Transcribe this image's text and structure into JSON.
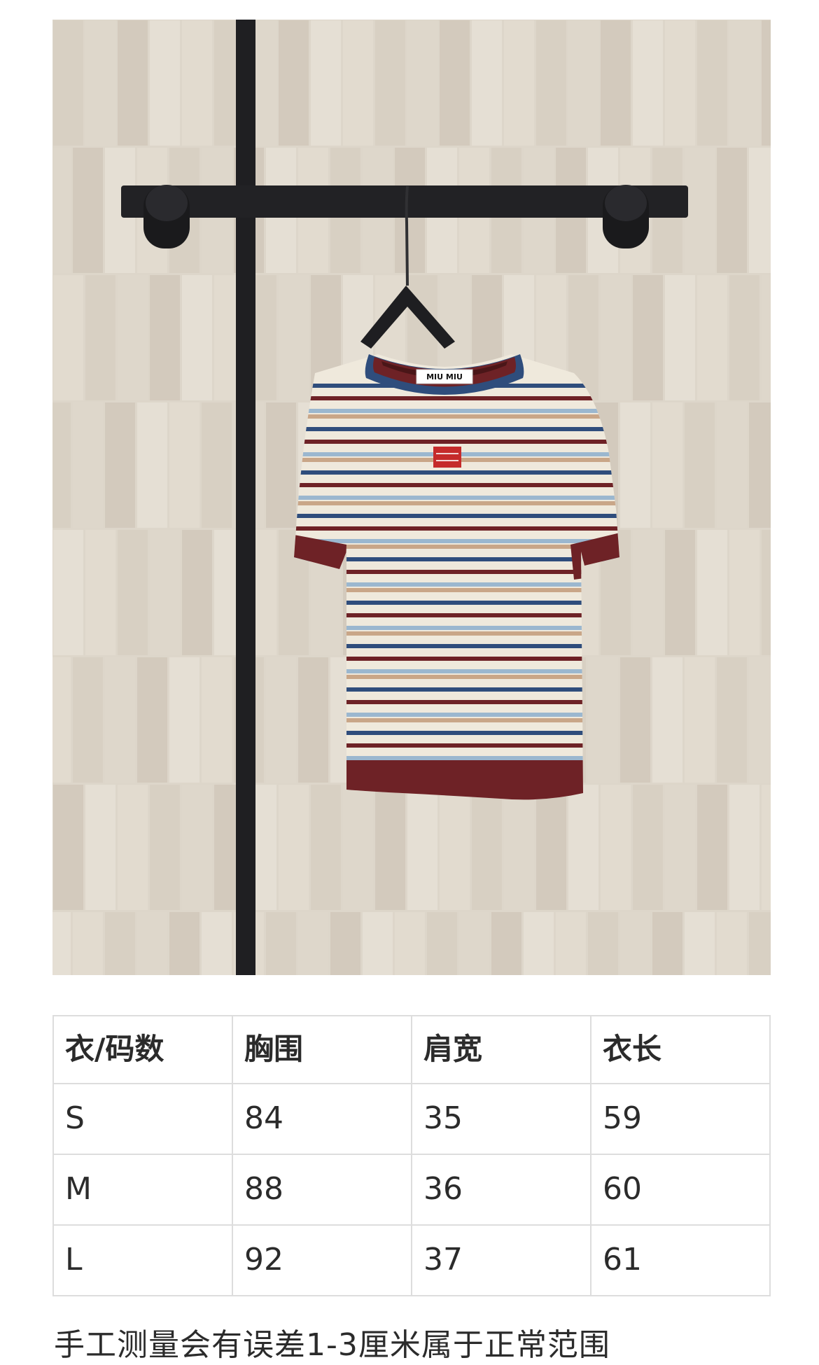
{
  "photo": {
    "icon": "striped-knit-tshirt-on-hanger-photo",
    "label_text": "MIU MIU",
    "colors": {
      "wall": "#ddd6ca",
      "rail": "#1f1f22",
      "navy": "#2f4d7c",
      "burgundy": "#6e2226",
      "cream": "#efe9dc",
      "light_blue": "#9bb7cf",
      "tan": "#c9a688",
      "logo_red": "#c52b2b"
    }
  },
  "size_table": {
    "headers": [
      "衣/码数",
      "胸围",
      "肩宽",
      "衣长"
    ],
    "rows": [
      [
        "S",
        "84",
        "35",
        "59"
      ],
      [
        "M",
        "88",
        "36",
        "60"
      ],
      [
        "L",
        "92",
        "37",
        "61"
      ]
    ]
  },
  "note": "手工测量会有误差1-3厘米属于正常范围"
}
